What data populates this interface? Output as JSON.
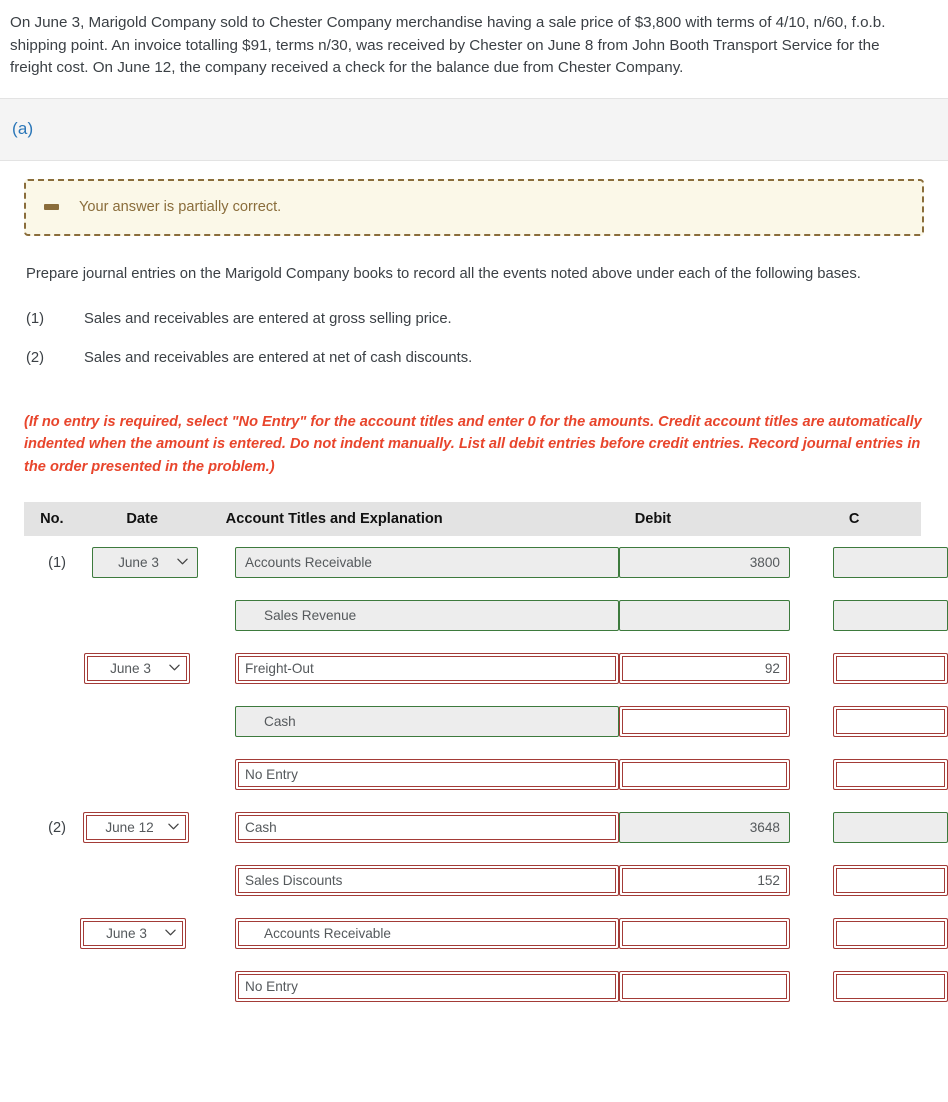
{
  "problem": {
    "text": "On June 3, Marigold Company sold to Chester Company merchandise having a sale price of $3,800 with terms of 4/10, n/60, f.o.b. shipping point. An invoice totalling $91, terms n/30, was received by Chester on June 8 from John Booth Transport Service for the freight cost. On June 12, the company received a check for the balance due from Chester Company."
  },
  "part": {
    "label": "(a)"
  },
  "banner": {
    "icon": "minus-icon",
    "text": "Your answer is partially correct."
  },
  "prompt": {
    "text": "Prepare journal entries on the Marigold Company books to record all the events noted above under each of the following bases."
  },
  "bases": [
    {
      "num": "(1)",
      "text": "Sales and receivables are entered at gross selling price."
    },
    {
      "num": "(2)",
      "text": "Sales and receivables are entered at net of cash discounts."
    }
  ],
  "note": {
    "text": "(If no entry is required, select \"No Entry\" for the account titles and enter 0 for the amounts. Credit account titles are automatically indented when the amount is entered. Do not indent manually. List all debit entries before credit entries. Record journal entries in the order presented in the problem.)"
  },
  "table": {
    "headers": {
      "no": "No.",
      "date": "Date",
      "account": "Account Titles and Explanation",
      "debit": "Debit",
      "credit": "C"
    },
    "rows": [
      {
        "no": "(1)",
        "date": "June 3",
        "date_state": "ok",
        "account": "Accounts Receivable",
        "account_state": "ok",
        "indent": false,
        "debit": "3800",
        "debit_state": "ok",
        "credit": "",
        "credit_state": "ok"
      },
      {
        "no": "",
        "date": "",
        "date_state": "none",
        "account": "Sales Revenue",
        "account_state": "ok",
        "indent": true,
        "debit": "",
        "debit_state": "ok",
        "credit": "",
        "credit_state": "ok"
      },
      {
        "no": "",
        "date": "June 3",
        "date_state": "bad",
        "account": "Freight-Out",
        "account_state": "bad",
        "indent": false,
        "debit": "92",
        "debit_state": "bad",
        "credit": "",
        "credit_state": "bad"
      },
      {
        "no": "",
        "date": "",
        "date_state": "none",
        "account": "Cash",
        "account_state": "ok",
        "indent": true,
        "debit": "",
        "debit_state": "bad",
        "credit": "",
        "credit_state": "bad"
      },
      {
        "no": "",
        "date": "",
        "date_state": "none",
        "account": "No Entry",
        "account_state": "bad",
        "indent": false,
        "debit": "",
        "debit_state": "bad",
        "credit": "",
        "credit_state": "bad"
      },
      {
        "no": "(2)",
        "date": "June 12",
        "date_state": "bad",
        "account": "Cash",
        "account_state": "bad",
        "indent": false,
        "debit": "3648",
        "debit_state": "ok",
        "credit": "",
        "credit_state": "ok"
      },
      {
        "no": "",
        "date": "",
        "date_state": "none",
        "account": "Sales Discounts",
        "account_state": "bad",
        "indent": false,
        "debit": "152",
        "debit_state": "bad",
        "credit": "",
        "credit_state": "bad"
      },
      {
        "no": "",
        "date": "June 3",
        "date_state": "bad",
        "account": "Accounts Receivable",
        "account_state": "bad",
        "indent": true,
        "debit": "",
        "debit_state": "bad",
        "credit": "",
        "credit_state": "bad"
      },
      {
        "no": "",
        "date": "",
        "date_state": "none",
        "account": "No Entry",
        "account_state": "bad",
        "indent": false,
        "debit": "",
        "debit_state": "bad",
        "credit": "",
        "credit_state": "bad"
      }
    ]
  },
  "colors": {
    "correct_border": "#3d7a3d",
    "incorrect_border": "#a33b37",
    "banner_border": "#8a6d3b",
    "banner_bg": "#fbf8e8",
    "note_text": "#e8452c",
    "part_label": "#2a76b8",
    "header_bg": "#e3e3e3",
    "field_bg": "#ededed"
  }
}
